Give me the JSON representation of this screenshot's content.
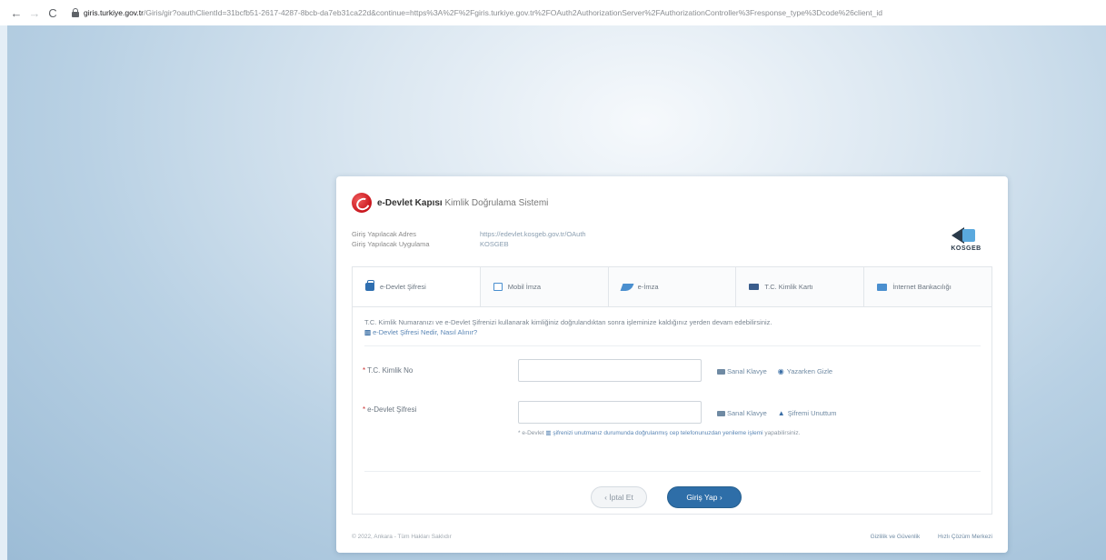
{
  "browser": {
    "back": "←",
    "forward": "→",
    "reload": "C",
    "url_host": "giris.turkiye.gov.tr",
    "url_rest": "/Giris/gir?oauthClientId=31bcfb51-2617-4287-8bcb-da7eb31ca22d&continue=https%3A%2F%2Fgiris.turkiye.gov.tr%2FOAuth2AuthorizationServer%2FAuthorizationController%3Fresponse_type%3Dcode%26client_id"
  },
  "header": {
    "brand_bold": "e-Devlet Kapısı",
    "brand_rest": "Kimlik Doğrulama Sistemi"
  },
  "info": {
    "address_label": "Giriş Yapılacak Adres",
    "address_value": "https://edevlet.kosgeb.gov.tr/OAuth",
    "app_label": "Giriş Yapılacak Uygulama",
    "app_value": "KOSGEB"
  },
  "partner_logo": "KOSGEB",
  "tabs": [
    {
      "label": "e-Devlet Şifresi",
      "icon": "wallet-icon"
    },
    {
      "label": "Mobil İmza",
      "icon": "sim-icon"
    },
    {
      "label": "e-İmza",
      "icon": "pen-icon"
    },
    {
      "label": "T.C. Kimlik Kartı",
      "icon": "id-card-icon"
    },
    {
      "label": "İnternet Bankacılığı",
      "icon": "bank-card-icon"
    }
  ],
  "description": {
    "text": "T.C. Kimlik Numaranızı ve e-Devlet Şifrenizi kullanarak kimliğiniz doğrulandıktan sonra işleminize kaldığınız yerden devam edebilirsiniz.",
    "help_link": "e-Devlet Şifresi Nedir, Nasıl Alınır?"
  },
  "form": {
    "tc_label": "T.C. Kimlik No",
    "tc_value": "",
    "password_label": "e-Devlet Şifresi",
    "password_value": "",
    "virtual_keyboard": "Sanal Klavye",
    "show_text": "Yazarken Gizle",
    "forgot_password": "Şifremi Unuttum",
    "hint_prefix": "* e-Devlet",
    "hint_link": "şifrenizi unutmanız durumunda doğrulanmış cep telefonunuzdan yenileme işlemi",
    "hint_suffix": "yapabilirsiniz."
  },
  "buttons": {
    "cancel": "‹ İptal Et",
    "login": "Giriş Yap ›"
  },
  "footer": {
    "copyright": "© 2022, Ankara - Tüm Hakları Saklıdır",
    "privacy": "Gizlilik ve Güvenlik",
    "help": "Hızlı Çözüm Merkezi"
  },
  "colors": {
    "primary": "#2e6ea8",
    "logo_red": "#c8161d",
    "link": "#5a86b5"
  }
}
